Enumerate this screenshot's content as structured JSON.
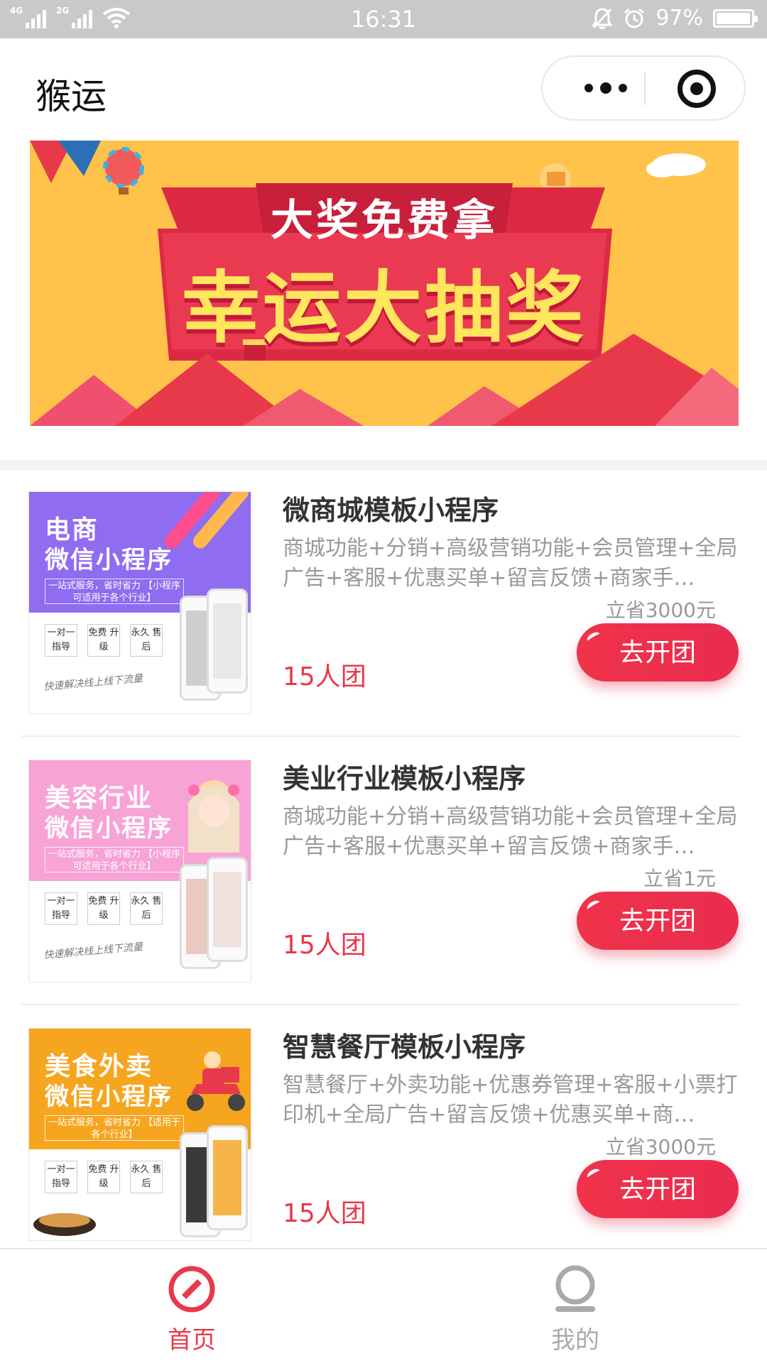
{
  "status_bar": {
    "net1": "4G",
    "net2": "2G",
    "time": "16:31",
    "battery": "97%",
    "battery_level": 0.97
  },
  "title_bar": {
    "title": "猴运"
  },
  "banner": {
    "subtitle": "大奖免费拿",
    "title": "幸运大抽奖"
  },
  "thumbs_common": {
    "box1": "一对一 指导",
    "box2": "免费 升级",
    "box3": "永久 售后",
    "script": "快速解决线上线下流量"
  },
  "products": [
    {
      "name": "微商城模板小程序",
      "desc": "商城功能+分销+高级营销功能+会员管理+全局广告+客服+优惠买单+留言反馈+商家手…",
      "save": "立省3000元",
      "group": "15人团",
      "button": "去开团",
      "thumb_line1": "电商",
      "thumb_line2": "微信小程序",
      "thumb_line3": "一站式服务，省时省力 【小程序可适用于各个行业】",
      "thumb_color": "#8f6cf0"
    },
    {
      "name": "美业行业模板小程序",
      "desc": "商城功能+分销+高级营销功能+会员管理+全局广告+客服+优惠买单+留言反馈+商家手…",
      "save": "立省1元",
      "group": "15人团",
      "button": "去开团",
      "thumb_line1": "美容行业",
      "thumb_line2": "微信小程序",
      "thumb_line3": "一站式服务，省时省力 【小程序可适用于各个行业】",
      "thumb_color": "#f7a3d6"
    },
    {
      "name": "智慧餐厅模板小程序",
      "desc": "智慧餐厅+外卖功能+优惠券管理+客服+小票打印机+全局广告+留言反馈+优惠买单+商…",
      "save": "立省3000元",
      "group": "15人团",
      "button": "去开团",
      "thumb_line1": "美食外卖",
      "thumb_line2": "微信小程序",
      "thumb_line3": "一站式服务，省时省力 【适用于各个行业】",
      "thumb_color": "#f6a51e"
    }
  ],
  "tabs": {
    "home": "首页",
    "me": "我的"
  },
  "colors": {
    "accent": "#e8394a",
    "banner_bg": "#ffc24a",
    "inactive": "#aaaaaa"
  }
}
